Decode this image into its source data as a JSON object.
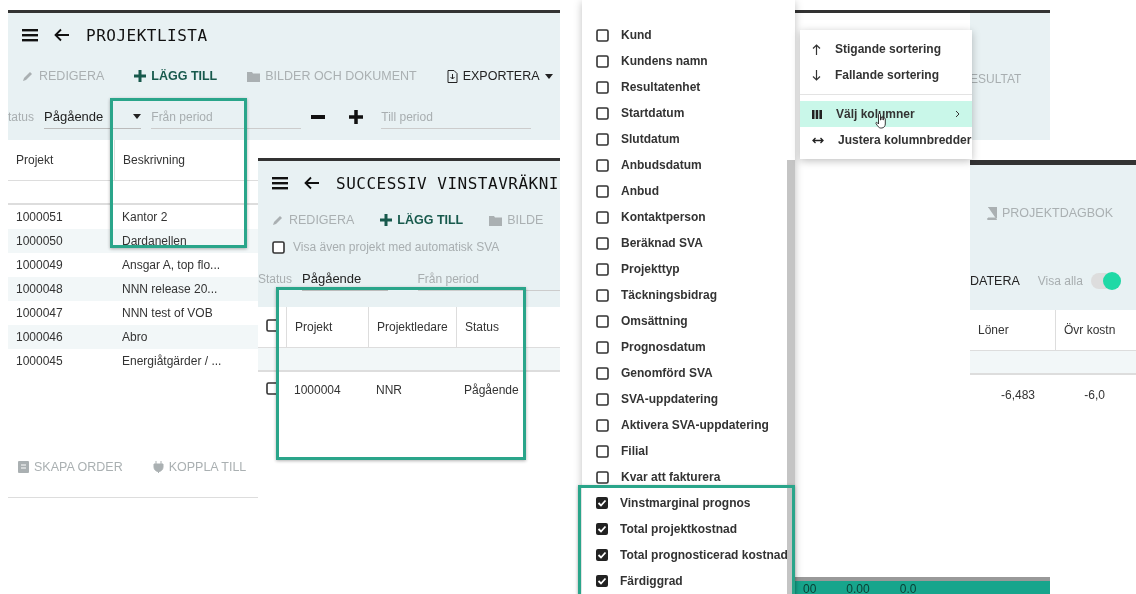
{
  "projektlista": {
    "title": "PROJEKTLISTA",
    "toolbar": [
      {
        "label": "REDIGERA",
        "kind": "edit",
        "disabled": true
      },
      {
        "label": "LÄGG TILL",
        "kind": "add",
        "disabled": false
      },
      {
        "label": "BILDER OCH DOKUMENT",
        "kind": "folder",
        "disabled": true
      },
      {
        "label": "EXPORTERA",
        "kind": "export",
        "disabled": false
      }
    ],
    "filter": {
      "status_label": "tatus",
      "status_value": "Pågående",
      "from_placeholder": "Från period",
      "to_placeholder": "Till period"
    },
    "columns": [
      "Projekt",
      "Beskrivning"
    ],
    "rows": [
      {
        "projekt": "1000051",
        "beskrivning": "Kantor 2"
      },
      {
        "projekt": "1000050",
        "beskrivning": "Dardanellen"
      },
      {
        "projekt": "1000049",
        "beskrivning": "Ansgar A, top flo..."
      },
      {
        "projekt": "1000048",
        "beskrivning": "NNN release 20..."
      },
      {
        "projekt": "1000047",
        "beskrivning": "NNN test of VOB"
      },
      {
        "projekt": "1000046",
        "beskrivning": "Abro"
      },
      {
        "projekt": "1000045",
        "beskrivning": "Energiåtgärder / ..."
      }
    ],
    "footer_actions": [
      {
        "label": "SKAPA ORDER",
        "kind": "order",
        "disabled": true
      },
      {
        "label": "KOPPLA TILL",
        "kind": "plug",
        "disabled": true
      }
    ]
  },
  "successiv": {
    "title": "SUCCESSIV VINSTAVRÄKNI",
    "toolbar": [
      {
        "label": "REDIGERA",
        "kind": "edit",
        "disabled": true
      },
      {
        "label": "LÄGG TILL",
        "kind": "add",
        "disabled": false
      },
      {
        "label": "BILDE",
        "kind": "folder",
        "disabled": true
      }
    ],
    "show_auto": {
      "label": "Visa även projekt med automatisk SVA",
      "checked": false
    },
    "filter": {
      "status_label": "Status",
      "status_value": "Pågående",
      "from_placeholder": "Från period"
    },
    "select_all": {
      "checked": false
    },
    "columns": [
      "Projekt",
      "Projektledare",
      "Status"
    ],
    "rows": [
      {
        "checked": false,
        "projekt": "1000004",
        "projektledare": "NNR",
        "status": "Pågående"
      }
    ]
  },
  "column_chooser": {
    "items": [
      {
        "label": "Kund",
        "checked": false
      },
      {
        "label": "Kundens namn",
        "checked": false
      },
      {
        "label": "Resultatenhet",
        "checked": false
      },
      {
        "label": "Startdatum",
        "checked": false
      },
      {
        "label": "Slutdatum",
        "checked": false
      },
      {
        "label": "Anbudsdatum",
        "checked": false
      },
      {
        "label": "Anbud",
        "checked": false
      },
      {
        "label": "Kontaktperson",
        "checked": false
      },
      {
        "label": "Beräknad SVA",
        "checked": false
      },
      {
        "label": "Projekttyp",
        "checked": false
      },
      {
        "label": "Täckningsbidrag",
        "checked": false
      },
      {
        "label": "Omsättning",
        "checked": false
      },
      {
        "label": "Prognosdatum",
        "checked": false
      },
      {
        "label": "Genomförd SVA",
        "checked": false
      },
      {
        "label": "SVA-uppdatering",
        "checked": false
      },
      {
        "label": "Aktivera SVA-uppdatering",
        "checked": false
      },
      {
        "label": "Filial",
        "checked": false
      },
      {
        "label": "Kvar att fakturera",
        "checked": false
      },
      {
        "label": "Vinstmarginal prognos",
        "checked": true
      },
      {
        "label": "Total projektkostnad",
        "checked": true
      },
      {
        "label": "Total prognosticerad kostnad",
        "checked": true
      },
      {
        "label": "Färdiggrad",
        "checked": true
      }
    ]
  },
  "sort_menu": {
    "items": [
      {
        "label": "Stigande sortering",
        "kind": "asc",
        "selected": false
      },
      {
        "label": "Fallande sortering",
        "kind": "desc",
        "selected": false
      },
      {
        "label": "Välj kolumner",
        "kind": "columns",
        "selected": true
      },
      {
        "label": "Justera kolumnbredder",
        "kind": "widths",
        "selected": false
      }
    ]
  },
  "background_window": {
    "toolbar_text": "ESULTAT",
    "totals": [
      "00",
      "0.00",
      "0.0"
    ]
  },
  "projektdagbok_window": {
    "action": "PROJEKTDAGBOK",
    "update_action": "DATERA",
    "show_all": {
      "label": "Visa alla",
      "on": true
    },
    "columns": [
      "Löner",
      "Övr kostn"
    ],
    "rows": [
      {
        "column_1": "-6,483",
        "column_2": "-6,0"
      }
    ]
  }
}
